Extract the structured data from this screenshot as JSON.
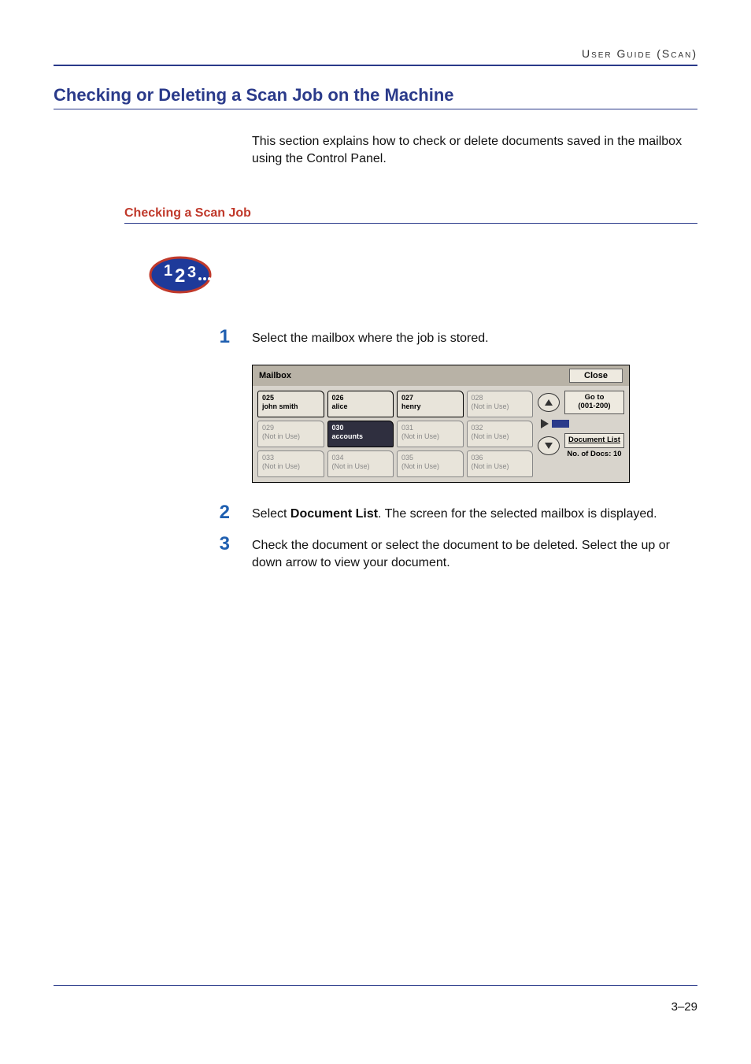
{
  "header": {
    "breadcrumb": "User Guide (Scan)"
  },
  "h1": "Checking or Deleting a Scan Job on the Machine",
  "intro": "This section explains how to check or delete documents saved in the mailbox using the Control Panel.",
  "h2": "Checking a Scan Job",
  "steps": [
    {
      "num": "1",
      "text": "Select the mailbox where the job is stored."
    },
    {
      "num": "2",
      "prefix": "Select ",
      "bold": "Document List",
      "suffix": ". The screen for the selected mailbox is displayed."
    },
    {
      "num": "3",
      "text": "Check the document or select the document to be deleted. Select the up or down arrow to view your document."
    }
  ],
  "mailbox_ui": {
    "title": "Mailbox",
    "close_label": "Close",
    "goto_label_line1": "Go to",
    "goto_label_line2": "(001-200)",
    "doclist_label": "Document List",
    "docs_count_label": "No. of Docs: 10",
    "tabs": [
      {
        "num": "025",
        "name": "john smith",
        "state": "active"
      },
      {
        "num": "026",
        "name": "alice",
        "state": "active"
      },
      {
        "num": "027",
        "name": "henry",
        "state": "active"
      },
      {
        "num": "028",
        "name": "(Not in Use)",
        "state": "disabled"
      },
      {
        "num": "029",
        "name": "(Not in Use)",
        "state": "disabled"
      },
      {
        "num": "030",
        "name": "accounts",
        "state": "selected"
      },
      {
        "num": "031",
        "name": "(Not in Use)",
        "state": "disabled"
      },
      {
        "num": "032",
        "name": "(Not in Use)",
        "state": "disabled"
      },
      {
        "num": "033",
        "name": "(Not in Use)",
        "state": "disabled"
      },
      {
        "num": "034",
        "name": "(Not in Use)",
        "state": "disabled"
      },
      {
        "num": "035",
        "name": "(Not in Use)",
        "state": "disabled"
      },
      {
        "num": "036",
        "name": "(Not in Use)",
        "state": "disabled"
      }
    ]
  },
  "footer": {
    "page": "3–29"
  }
}
